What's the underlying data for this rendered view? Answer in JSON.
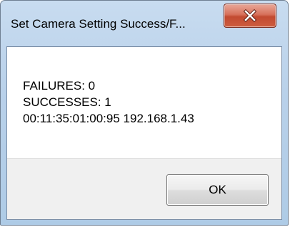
{
  "window": {
    "title": "Set Camera Setting Success/F..."
  },
  "titlebar_buttons": {
    "close_icon": "close-icon"
  },
  "message": {
    "failures": "FAILURES: 0",
    "successes": "SUCCESSES: 1",
    "device": "00:11:35:01:00:95  192.168.1.43"
  },
  "buttons": {
    "ok_label": "OK"
  },
  "colors": {
    "frame": "#b9d1ea",
    "close_button": "#c9533a",
    "footer": "#f0f0f0"
  }
}
